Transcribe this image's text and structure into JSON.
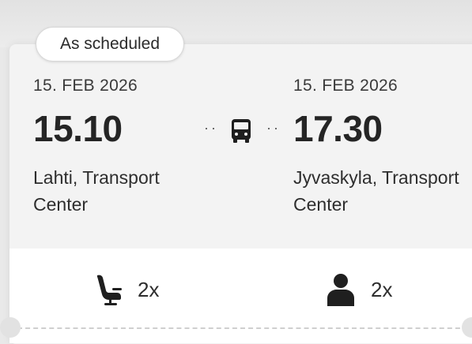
{
  "trip": {
    "status": "As scheduled",
    "departure": {
      "date": "15. FEB 2026",
      "time": "15.10",
      "place": "Lahti, Transport Center"
    },
    "arrival": {
      "date": "15. FEB 2026",
      "time": "17.30",
      "place": "Jyvaskyla, Transport Center"
    },
    "connector": {
      "dots": "··",
      "icon": "bus-icon"
    }
  },
  "booking": {
    "seats": {
      "icon": "seat-icon",
      "count": "2x"
    },
    "passengers": {
      "icon": "person-icon",
      "count": "2x"
    }
  },
  "colors": {
    "card_background": "#f3f3f3",
    "bottom_background": "#ffffff",
    "text": "#252525"
  }
}
